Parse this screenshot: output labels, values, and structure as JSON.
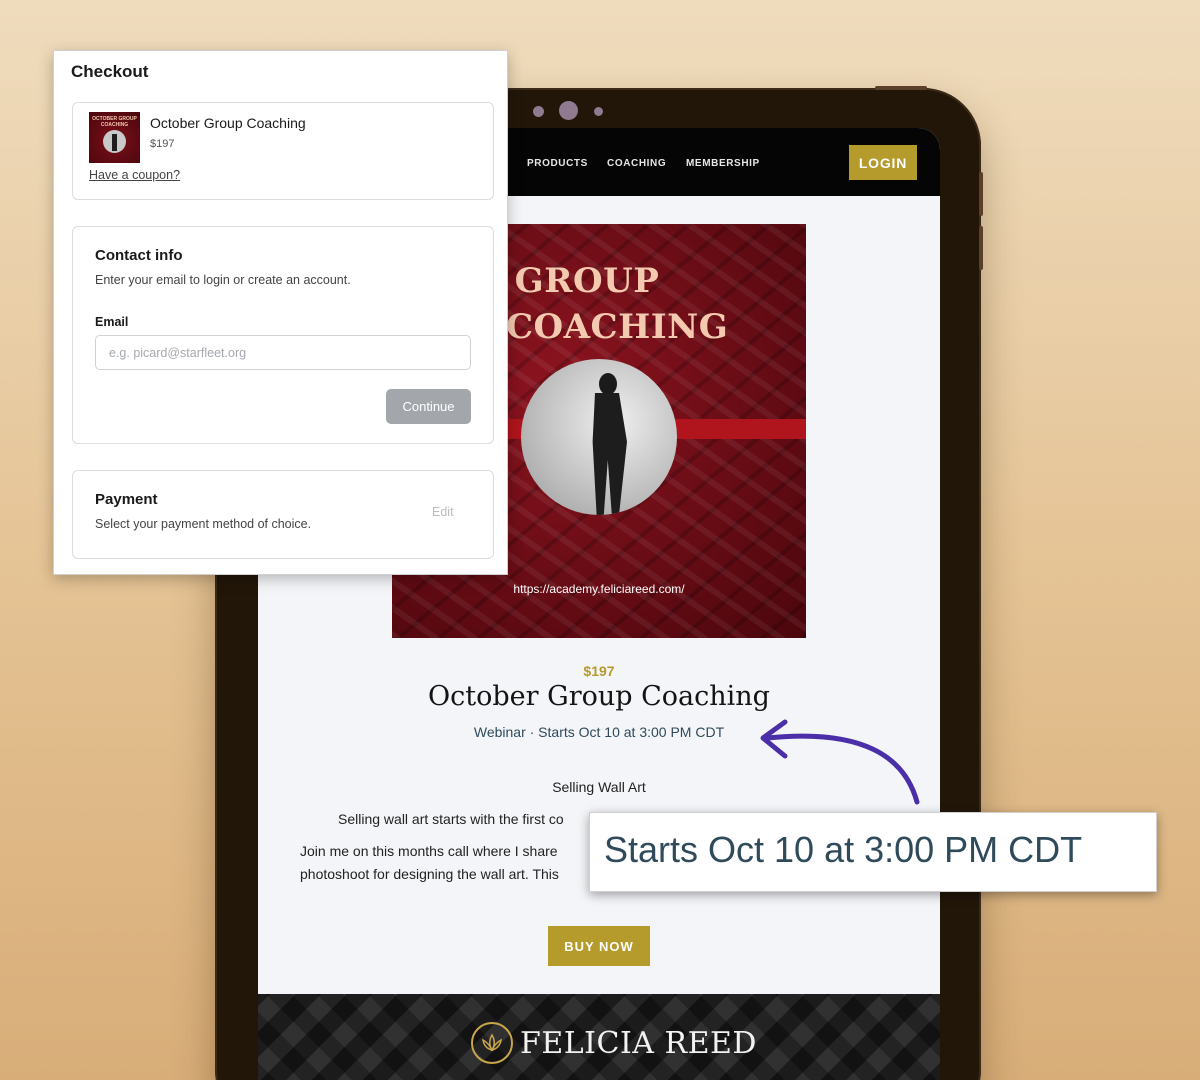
{
  "colors": {
    "gold": "#b59a2c",
    "nav_bg": "#050505",
    "hero_red": "#7b0f1a",
    "meta_text": "#2f4a5a",
    "arrow": "#4a2fa8"
  },
  "site": {
    "nav": {
      "items": [
        "PRODUCTS",
        "COACHING",
        "MEMBERSHIP"
      ],
      "login_label": "LOGIN"
    },
    "hero": {
      "title_line1": "TOBER GROUP",
      "title_line2": "COACHING",
      "url": "https://academy.feliciareed.com/"
    },
    "product": {
      "price": "$197",
      "title": "October Group Coaching",
      "meta": "Webinar · Starts Oct 10 at 3:00 PM CDT"
    },
    "description": {
      "heading": "Selling Wall Art",
      "line1": "Selling wall art starts with the first co",
      "line2": "Join me on this months call where I share",
      "line3": "photoshoot for designing the wall art. This"
    },
    "buy_label": "BUY NOW",
    "footer": {
      "logo_text": "FELICIA REED",
      "logo_icon": "lotus-icon"
    }
  },
  "checkout": {
    "title": "Checkout",
    "item": {
      "thumb_title": "OCTOBER GROUP COACHING",
      "name": "October Group Coaching",
      "price": "$197",
      "coupon_link": "Have a coupon?"
    },
    "contact": {
      "heading": "Contact info",
      "subtitle": "Enter your email to login or create an account.",
      "email_label": "Email",
      "email_placeholder": "e.g. picard@starfleet.org",
      "email_value": "",
      "continue_label": "Continue"
    },
    "payment": {
      "heading": "Payment",
      "subtitle": "Select your payment method of choice.",
      "edit_label": "Edit"
    }
  },
  "callout": {
    "text": "Starts Oct 10 at 3:00 PM CDT"
  }
}
